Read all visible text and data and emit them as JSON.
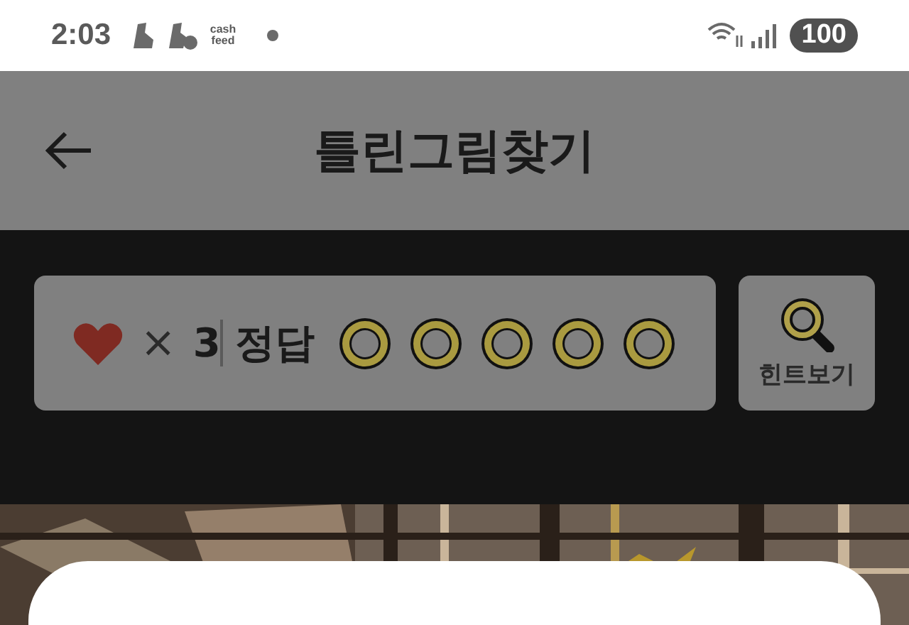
{
  "status_bar": {
    "time": "2:03",
    "notification_text": "cash feed",
    "battery": "100"
  },
  "header": {
    "title": "틀린그림찾기"
  },
  "game_bar": {
    "times": "×",
    "lives": "3",
    "answers_label": "정답",
    "answers": [
      {
        "found": false
      },
      {
        "found": false
      },
      {
        "found": false
      },
      {
        "found": false
      },
      {
        "found": false
      }
    ],
    "hint_button": "힌트보기"
  },
  "dialog": {
    "open": true
  }
}
